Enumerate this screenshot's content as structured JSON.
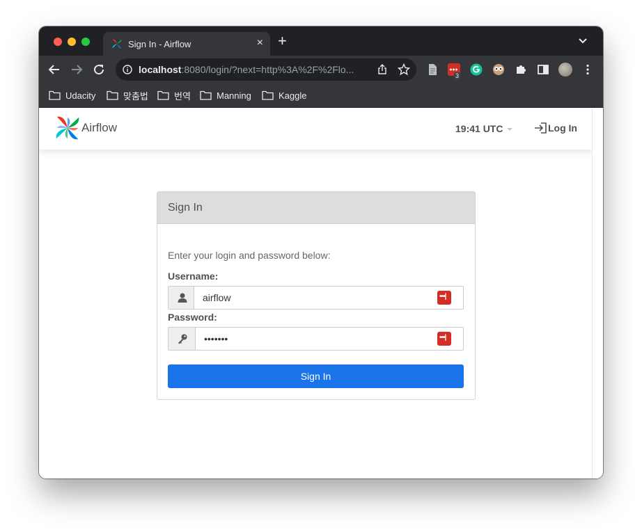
{
  "browser": {
    "tab_title": "Sign In - Airflow",
    "tab_close": "×",
    "new_tab": "+",
    "url_host": "localhost",
    "url_rest": ":8080/login/?next=http%3A%2F%2Flo...",
    "extension_badge": "3",
    "icons": [
      "back-icon",
      "forward-icon",
      "reload-icon",
      "info-icon",
      "share-icon",
      "star-icon",
      "document-icon",
      "lastpass-icon",
      "grammarly-icon",
      "extension-owl-icon",
      "puzzle-icon",
      "sidepanel-icon",
      "profile-avatar",
      "menu-icon",
      "tab-search-icon"
    ]
  },
  "bookmarks": [
    {
      "label": "Udacity"
    },
    {
      "label": "맞춤법"
    },
    {
      "label": "번역"
    },
    {
      "label": "Manning"
    },
    {
      "label": "Kaggle"
    }
  ],
  "navbar": {
    "brand": "Airflow",
    "clock": "19:41 UTC",
    "login_label": "Log In"
  },
  "login": {
    "title": "Sign In",
    "intro": "Enter your login and password below:",
    "username_label": "Username:",
    "username_value": "airflow",
    "password_label": "Password:",
    "password_value": "•••••••",
    "submit_label": "Sign In"
  },
  "colors": {
    "primary_button": "#1a73e8",
    "lastpass_red": "#d32d27",
    "airflow_blue": "#017cee",
    "airflow_green": "#00ad46",
    "airflow_red": "#e43921"
  }
}
